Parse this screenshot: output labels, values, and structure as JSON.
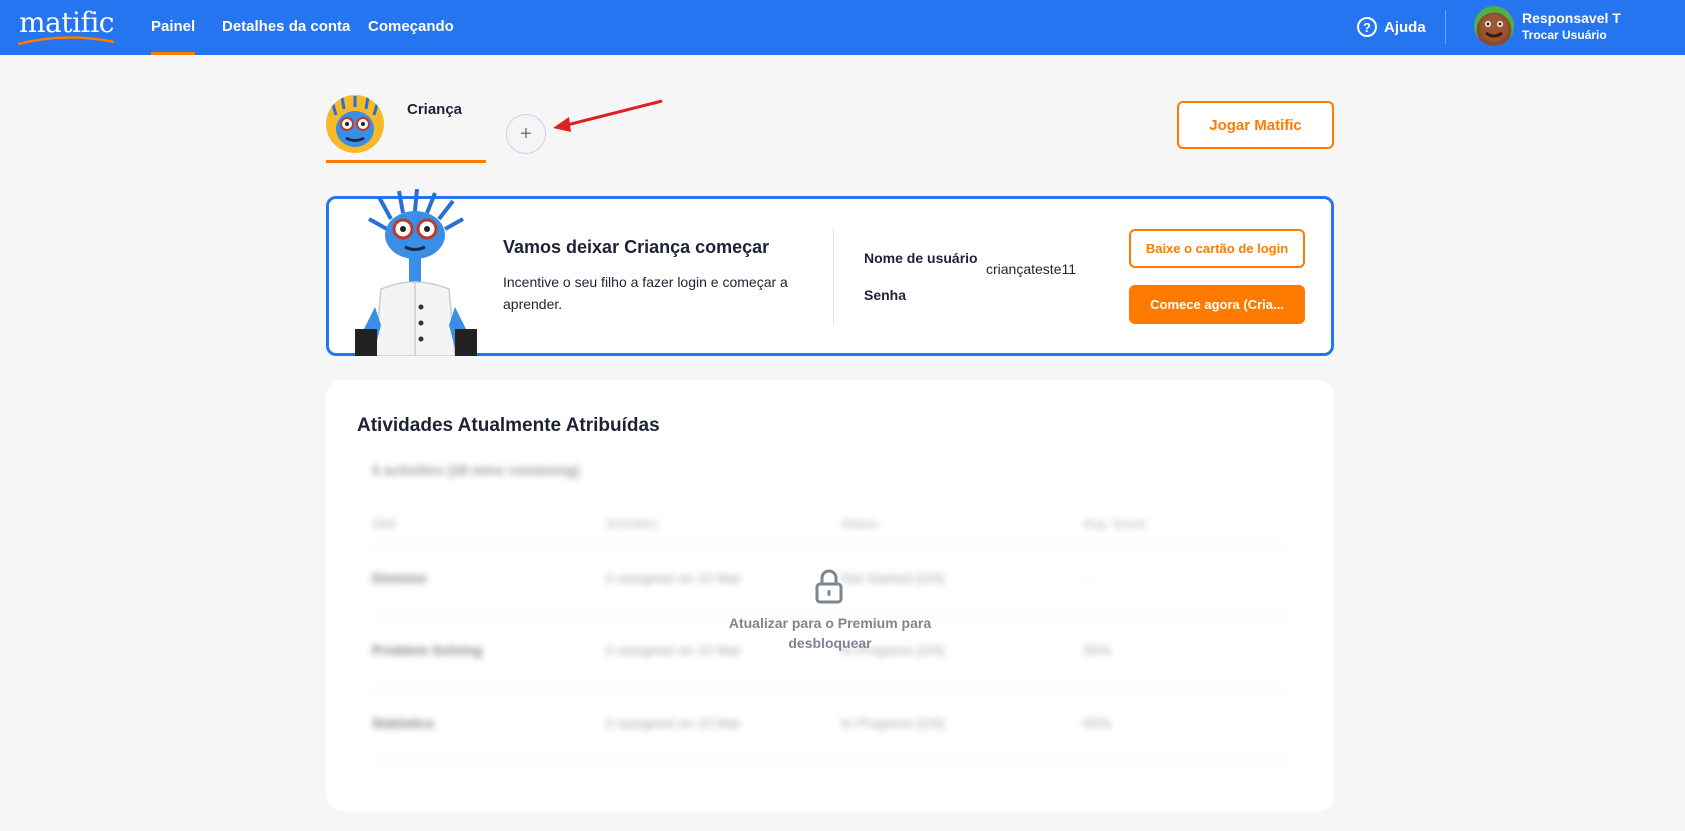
{
  "app": {
    "logo_text": "matific"
  },
  "nav": {
    "items": [
      {
        "label": "Painel",
        "active": true
      },
      {
        "label": "Detalhes da conta",
        "active": false
      },
      {
        "label": "Começando",
        "active": false
      }
    ],
    "help_label": "Ajuda",
    "user_name": "Responsavel T",
    "switch_user_label": "Trocar Usuário"
  },
  "children": {
    "tabs": [
      {
        "name": "Criança"
      }
    ],
    "add_label": "+"
  },
  "play_button_label": "Jogar Matific",
  "info_card": {
    "title": "Vamos deixar Criança começar",
    "description": "Incentive o seu filho a fazer login e começar a aprender.",
    "username_label": "Nome de usuário",
    "username_value": "criançateste11",
    "password_label": "Senha",
    "download_card_label": "Baixe o cartão de login",
    "start_now_label": "Comece agora (Cria..."
  },
  "activities": {
    "title": "Atividades Atualmente Atribuídas",
    "locked_message": "Atualizar para o Premium para desbloquear",
    "blurred": {
      "subtitle": "6 activities (28 mins remaining)",
      "headers": [
        "Skill",
        "Activities",
        "Status",
        "Avg. Score"
      ],
      "rows": [
        [
          "Division",
          "0 assigned on 10 Mar",
          "Not Started (0/4)",
          "-"
        ],
        [
          "Problem Solving",
          "0 assigned on 10 Mar",
          "In Progress (2/4)",
          "50%"
        ],
        [
          "Statistics",
          "0 assigned on 10 Mar",
          "In Progress (2/4)",
          "50%"
        ]
      ]
    }
  },
  "colors": {
    "brand_blue": "#2574f0",
    "accent_orange": "#ff7a00",
    "background": "#f6f6f6"
  }
}
